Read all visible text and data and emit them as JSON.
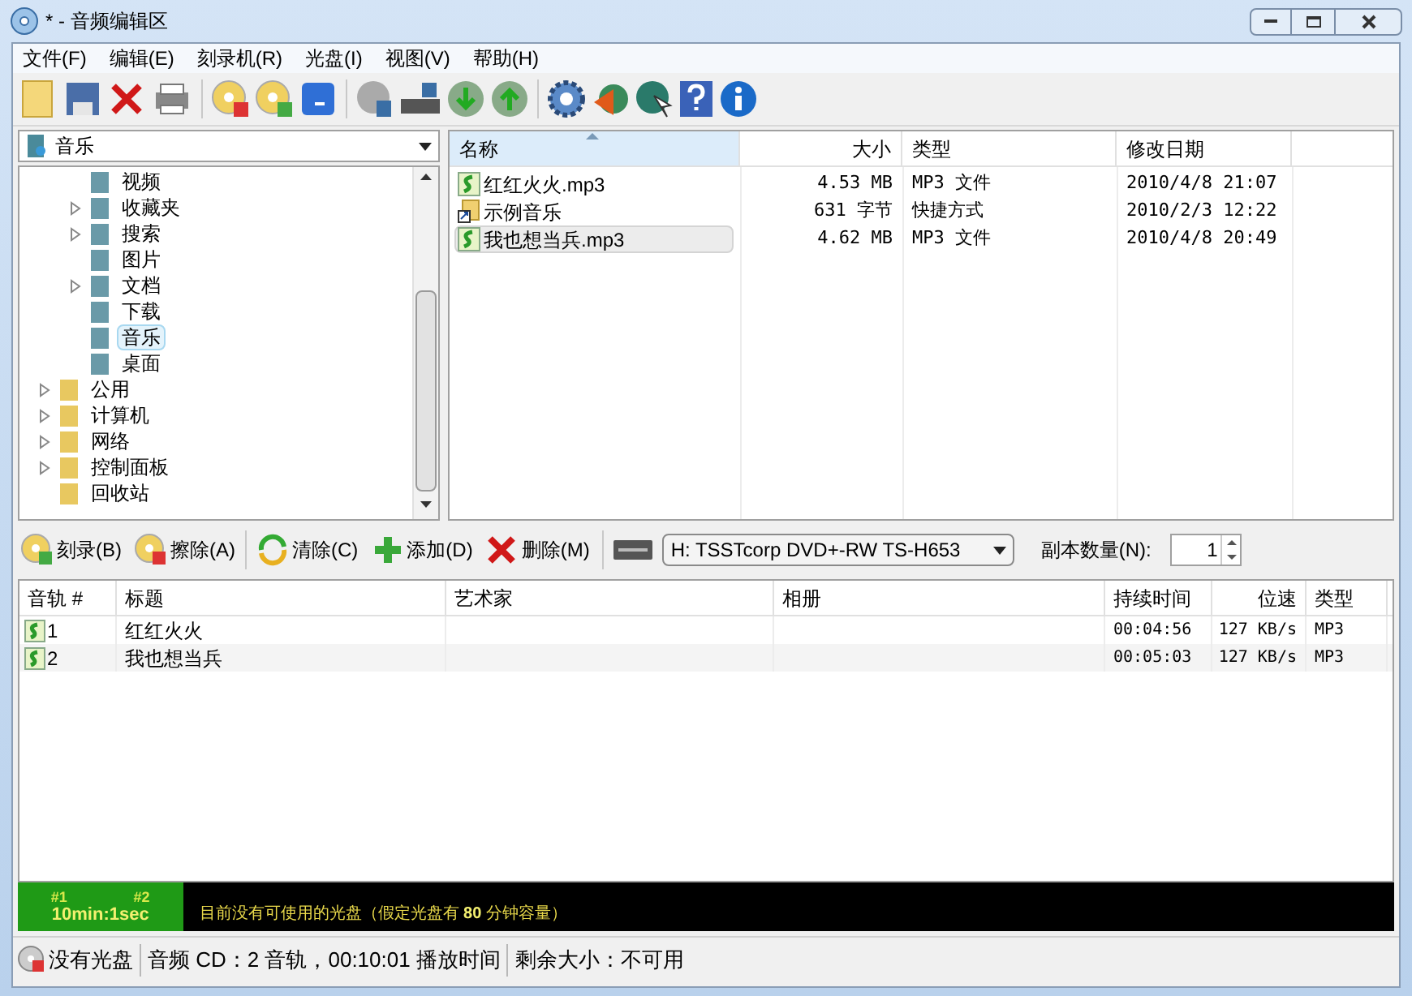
{
  "window": {
    "title": "* - 音频编辑区"
  },
  "menu": [
    "文件(F)",
    "编辑(E)",
    "刻录机(R)",
    "光盘(I)",
    "视图(V)",
    "帮助(H)"
  ],
  "location": {
    "label": "音乐"
  },
  "tree": [
    {
      "children": [
        {
          "label": "视频",
          "expandable": false,
          "selected": false
        },
        {
          "label": "收藏夹",
          "expandable": true,
          "selected": false
        },
        {
          "label": "搜索",
          "expandable": true,
          "selected": false
        },
        {
          "label": "图片",
          "expandable": false,
          "selected": false
        },
        {
          "label": "文档",
          "expandable": true,
          "selected": false
        },
        {
          "label": "下载",
          "expandable": false,
          "selected": false
        },
        {
          "label": "音乐",
          "expandable": false,
          "selected": true
        },
        {
          "label": "桌面",
          "expandable": false,
          "selected": false
        }
      ]
    },
    {
      "label": "公用",
      "expandable": true,
      "selected": false
    },
    {
      "label": "计算机",
      "expandable": true,
      "selected": false
    },
    {
      "label": "网络",
      "expandable": true,
      "selected": false
    },
    {
      "label": "控制面板",
      "expandable": true,
      "selected": false
    },
    {
      "label": "回收站",
      "expandable": false,
      "selected": false
    }
  ],
  "files": {
    "columns": [
      {
        "label": "名称",
        "sorted": true
      },
      {
        "label": "大小",
        "sorted": false
      },
      {
        "label": "类型",
        "sorted": false
      },
      {
        "label": "修改日期",
        "sorted": false
      }
    ],
    "rows": [
      {
        "kind": "mp3",
        "name": "红红火火.mp3",
        "size": "4.53 MB",
        "type": "MP3 文件",
        "date": "2010/4/8 21:07",
        "selected": false
      },
      {
        "kind": "shortcut",
        "name": "示例音乐",
        "size": "631 字节",
        "type": "快捷方式",
        "date": "2010/2/3 12:22",
        "selected": false
      },
      {
        "kind": "mp3",
        "name": "我也想当兵.mp3",
        "size": "4.62 MB",
        "type": "MP3 文件",
        "date": "2010/4/8 20:49",
        "selected": true
      }
    ]
  },
  "actions": [
    {
      "kind": "burn",
      "label": "刻录(B)"
    },
    {
      "kind": "erase",
      "label": "擦除(A)"
    },
    {
      "kind": "clear",
      "label": "清除(C)"
    },
    {
      "kind": "add",
      "label": "添加(D)"
    },
    {
      "kind": "delete",
      "label": "删除(M)"
    }
  ],
  "drive": {
    "value": "H: TSSTcorp DVD+-RW TS-H653"
  },
  "copies": {
    "label": "副本数量(N):",
    "value": "1"
  },
  "tracks": {
    "columns": [
      "音轨 #",
      "标题",
      "艺术家",
      "相册",
      "持续时间",
      "位速",
      "类型"
    ],
    "rows": [
      {
        "number": "1",
        "title": "红红火火",
        "duration": "00:04:56",
        "bitrate": "127 KB/s",
        "type": "MP3"
      },
      {
        "number": "2",
        "title": "我也想当兵",
        "duration": "00:05:03",
        "bitrate": "127 KB/s",
        "type": "MP3"
      }
    ]
  },
  "capacity": {
    "marks": [
      "#1",
      "#2"
    ],
    "used": "10min:1sec",
    "level": 0.12,
    "message": "目前没有可使用的光盘（假定光盘有 **80** 分钟容量）"
  },
  "status_bar": [
    "没有光盘",
    "音频 CD：2 音轨，00:10:01 播放时间",
    "剩余大小：不可用"
  ]
}
